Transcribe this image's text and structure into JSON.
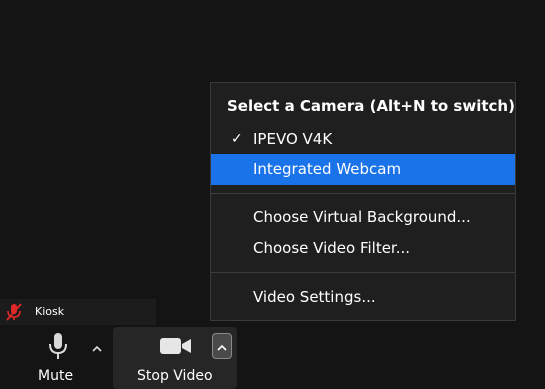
{
  "camera_menu": {
    "header": "Select a Camera (Alt+N to switch)",
    "items": [
      {
        "label": "IPEVO V4K",
        "checked": true
      },
      {
        "label": "Integrated Webcam",
        "highlighted": true
      },
      {
        "label": "Choose Virtual Background..."
      },
      {
        "label": "Choose Video Filter..."
      },
      {
        "label": "Video Settings..."
      }
    ]
  },
  "participant": {
    "name": "Kiosk",
    "muted_icon": "mic-off-icon"
  },
  "toolbar": {
    "mute_label": "Mute",
    "stop_video_label": "Stop Video"
  },
  "colors": {
    "highlight": "#1a73e8",
    "background": "#141414",
    "muted_red": "#e02828"
  }
}
